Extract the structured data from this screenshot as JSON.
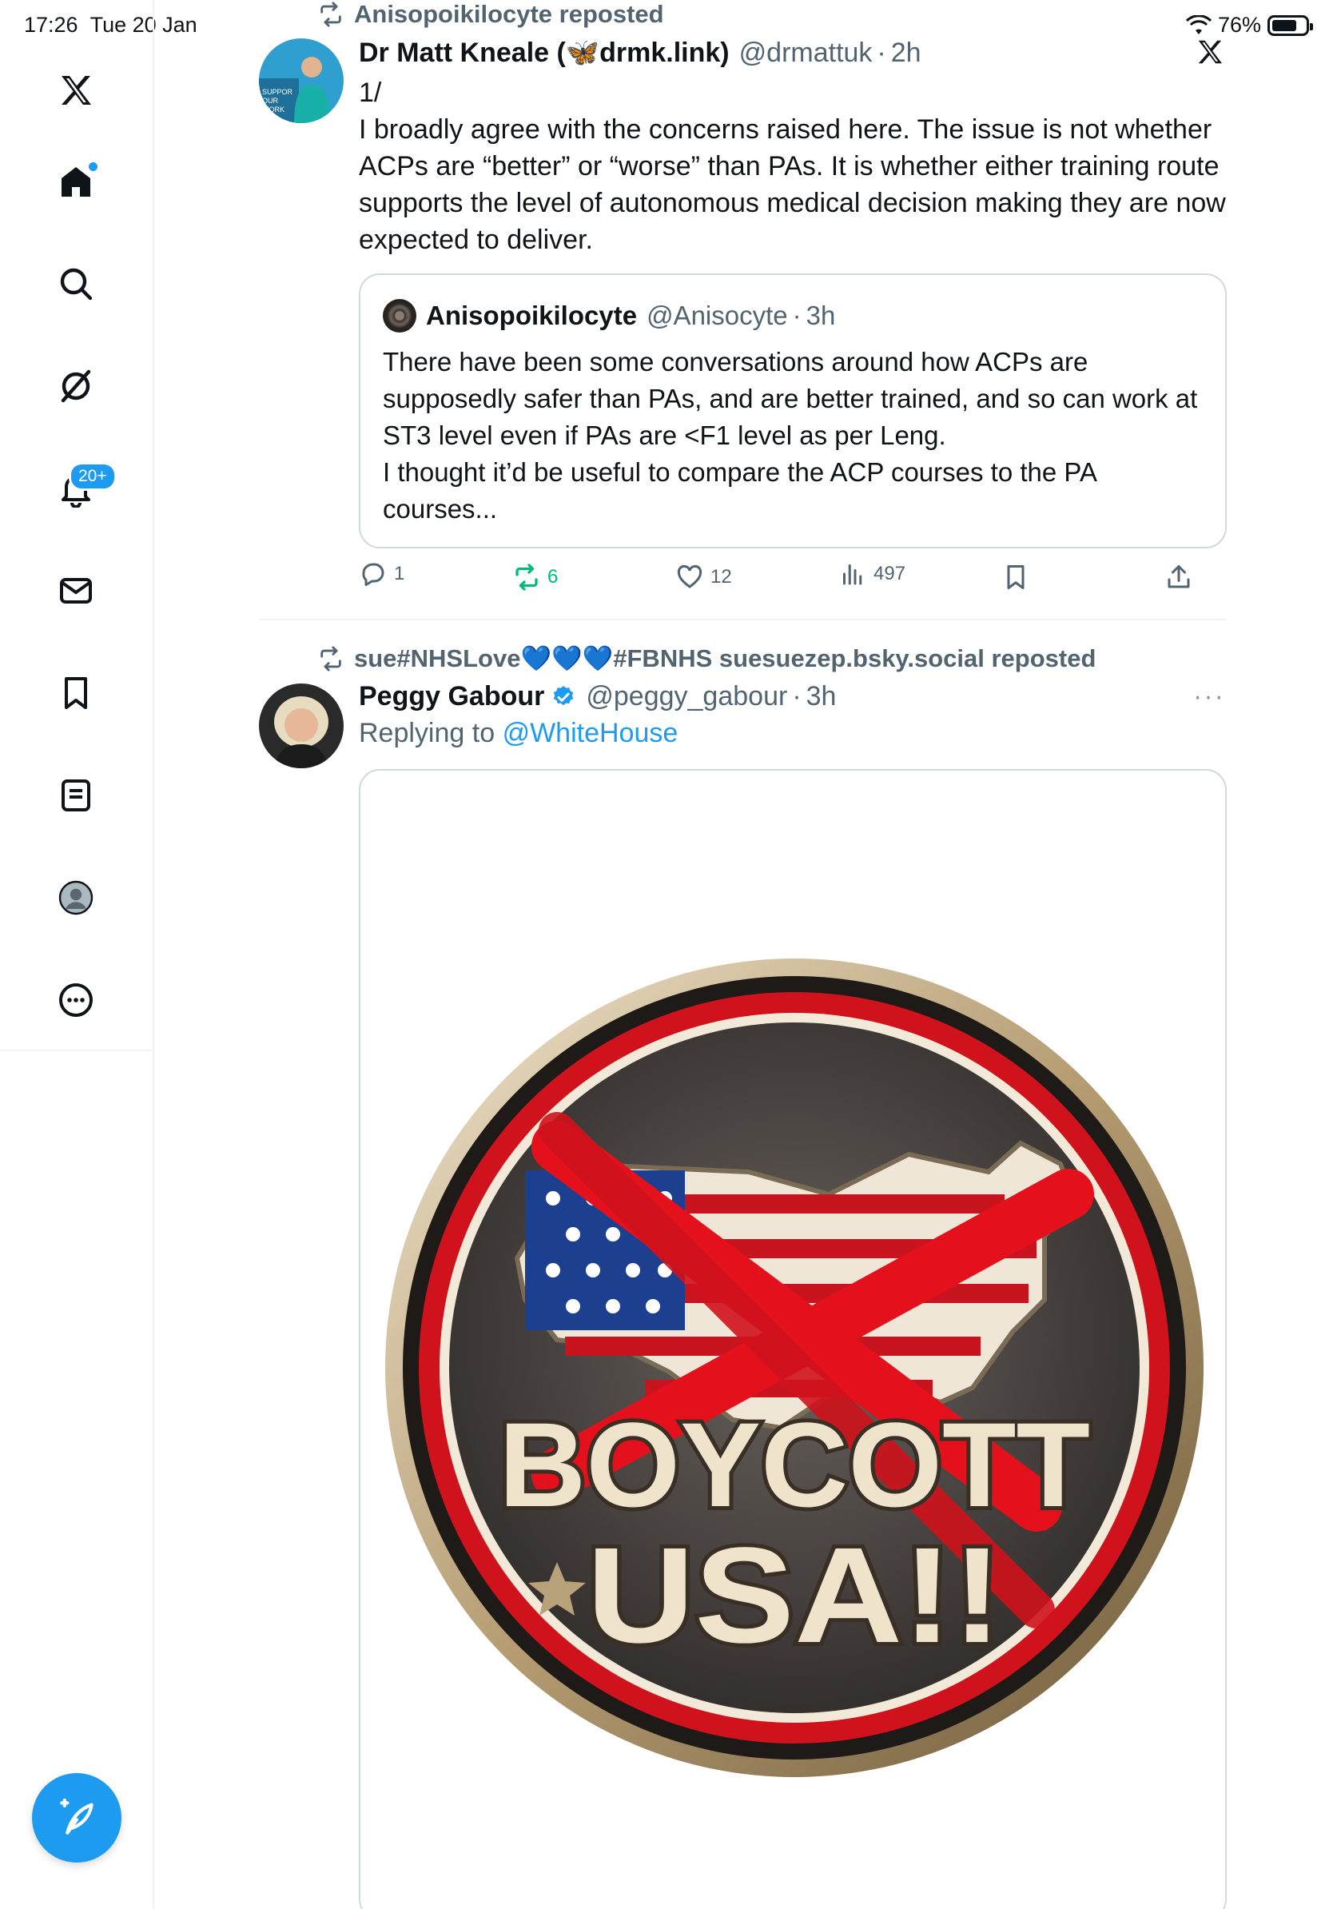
{
  "status_bar": {
    "time": "17:26",
    "date": "Tue 20 Jan",
    "battery": "76%"
  },
  "sidebar": {
    "notifications_badge": "20+",
    "items": [
      "x-logo",
      "home",
      "search",
      "grok",
      "notifications",
      "messages",
      "bookmarks",
      "lists",
      "profile",
      "more"
    ]
  },
  "posts": [
    {
      "reposted_by": "Anisopoikilocyte reposted",
      "name": "Dr Matt Kneale (🦋drmk.link)",
      "handle": "@drmattuk",
      "time": "2h",
      "text": "1/\nI broadly agree with the concerns raised here. The issue is not whether ACPs are “better” or “worse” than PAs. It is whether either training route supports the level of autonomous medical decision making they are now expected to deliver.",
      "quote": {
        "name": "Anisopoikilocyte",
        "handle": "@Anisocyte",
        "time": "3h",
        "text": "There have been some conversations around how ACPs are supposedly safer than PAs, and are better trained, and so can work at ST3 level even if PAs are <F1 level as per Leng.\nI thought it’d be useful to compare the ACP courses to the PA courses..."
      },
      "stats": {
        "replies": "1",
        "reposts": "6",
        "likes": "12",
        "views": "497"
      }
    },
    {
      "reposted_by": "sue#NHSLove💙💙💙#FBNHS suesuezep.bsky.social reposted",
      "name": "Peggy Gabour",
      "handle": "@peggy_gabour",
      "time": "3h",
      "replying_prefix": "Replying to",
      "replying_to": "@WhiteHouse",
      "more": "···",
      "image": {
        "line1": "BOYCOTT",
        "line2": "USA!!"
      }
    }
  ],
  "colors": {
    "accent": "#1d9bf0",
    "repost_green": "#00ba7c",
    "muted": "#536471",
    "badge_red": "#d0121c"
  }
}
